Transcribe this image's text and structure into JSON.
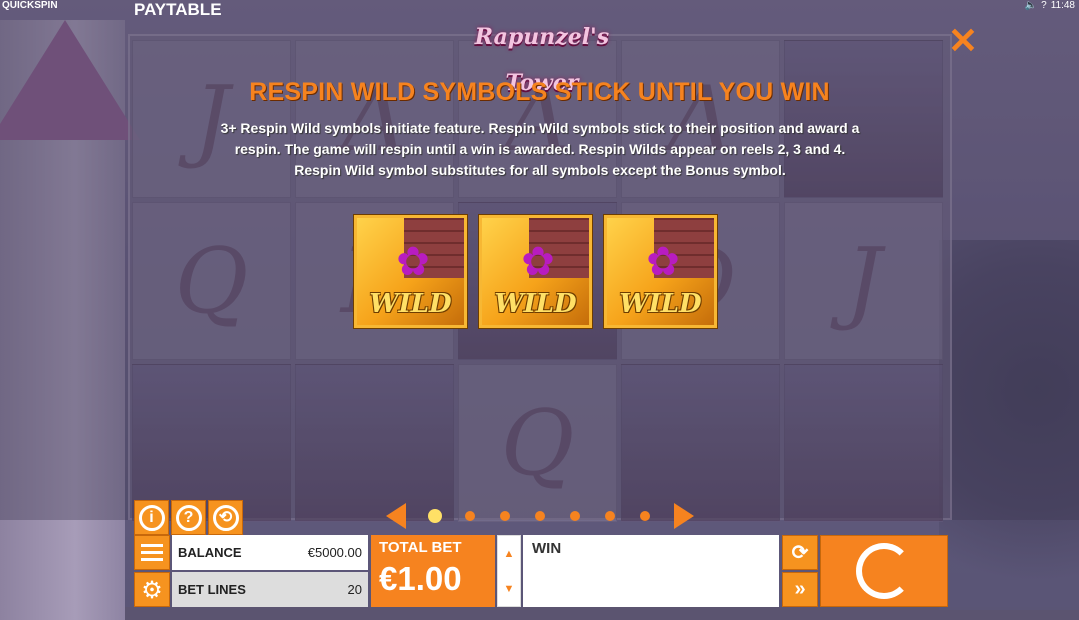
{
  "header": {
    "brand": "QUICKSPIN",
    "title": "PAYTABLE",
    "status_time": "11:48",
    "status_icons": [
      "volume-icon",
      "help-icon"
    ],
    "logo_text": "Rapunzel's Tower"
  },
  "feature": {
    "title": "RESPIN WILD SYMBOLS STICK UNTIL YOU WIN",
    "desc_line1": "3+ Respin Wild symbols initiate feature. Respin Wild symbols stick to their position and award a",
    "desc_line2": "respin. The game will respin until a win is awarded. Respin Wilds appear on reels 2, 3 and 4.",
    "desc_line3": "Respin Wild symbol substitutes for all symbols except the Bonus symbol.",
    "tiles": [
      "WILD",
      "WILD",
      "WILD"
    ]
  },
  "pager": {
    "pages": 7,
    "active": 1
  },
  "info_buttons": [
    "i",
    "?",
    "⟲"
  ],
  "bottom": {
    "balance_label": "BALANCE",
    "balance_value": "€5000.00",
    "lines_label": "BET LINES",
    "lines_value": "20",
    "total_bet_label": "TOTAL BET",
    "total_bet_value": "€1.00",
    "win_label": "WIN"
  },
  "colors": {
    "accent": "#f6831f",
    "accent_dark": "#c7680b"
  }
}
